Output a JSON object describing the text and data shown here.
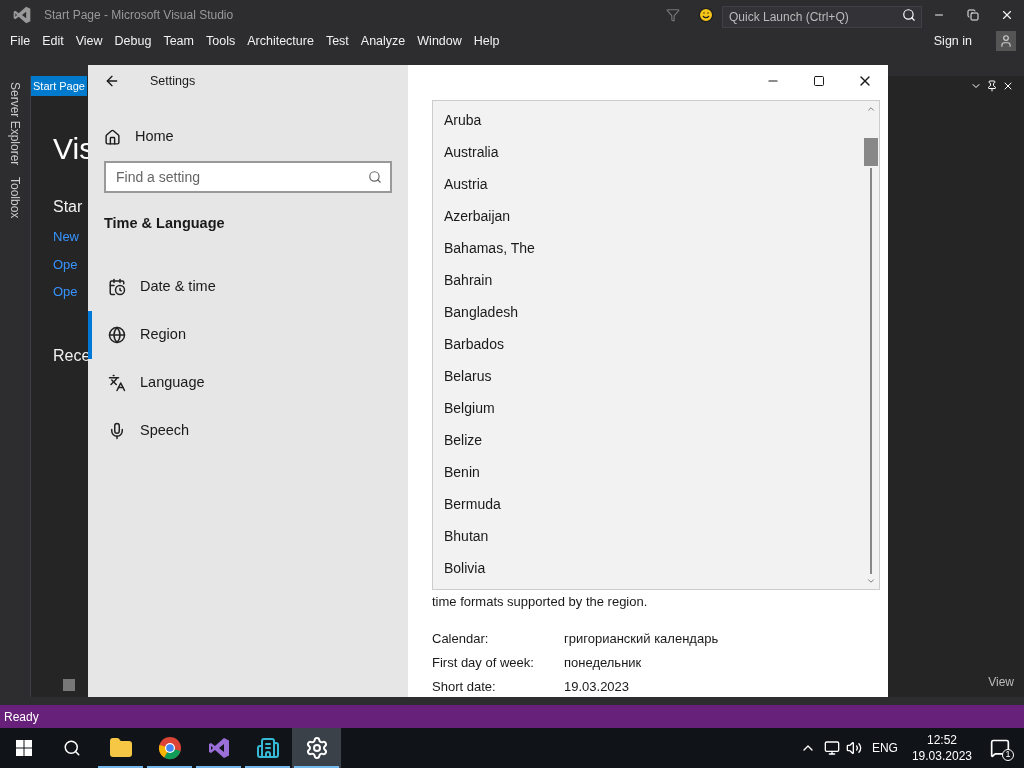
{
  "vs": {
    "title": "Start Page - Microsoft Visual Studio",
    "quick_launch": {
      "placeholder": "Quick Launch (Ctrl+Q)"
    },
    "menu": [
      "File",
      "Edit",
      "View",
      "Debug",
      "Team",
      "Tools",
      "Architecture",
      "Test",
      "Analyze",
      "Window",
      "Help"
    ],
    "sign_in": "Sign in",
    "side_tabs": [
      "Server Explorer",
      "Toolbox"
    ],
    "doc_tab": "Start Page",
    "start_page": {
      "heading": "Vis",
      "start_heading": "Star",
      "links": [
        "New",
        "Ope",
        "Ope"
      ],
      "recent_heading": "Rece"
    },
    "right_panel_footer": "View",
    "status": "Ready"
  },
  "settings": {
    "title": "Settings",
    "home": "Home",
    "search": {
      "placeholder": "Find a setting"
    },
    "section": "Time & Language",
    "nav": [
      {
        "label": "Date & time",
        "kind": "calendar",
        "selected": false
      },
      {
        "label": "Region",
        "kind": "globe",
        "selected": true
      },
      {
        "label": "Language",
        "kind": "language",
        "selected": false
      },
      {
        "label": "Speech",
        "kind": "mic",
        "selected": false
      }
    ],
    "country_list": [
      "Aruba",
      "Australia",
      "Austria",
      "Azerbaijan",
      "Bahamas, The",
      "Bahrain",
      "Bangladesh",
      "Barbados",
      "Belarus",
      "Belgium",
      "Belize",
      "Benin",
      "Bermuda",
      "Bhutan",
      "Bolivia"
    ],
    "region_text": "time formats supported by the region.",
    "formats": [
      {
        "label": "Calendar:",
        "value": "григорианский календарь"
      },
      {
        "label": "First day of week:",
        "value": "понедельник"
      },
      {
        "label": "Short date:",
        "value": "19.03.2023"
      }
    ]
  },
  "taskbar": {
    "apps": [
      {
        "kind": "files",
        "running": true,
        "selected": false
      },
      {
        "kind": "browser",
        "running": true,
        "selected": false
      },
      {
        "kind": "vs",
        "running": true,
        "selected": false
      },
      {
        "kind": "buildings",
        "running": true,
        "selected": false
      },
      {
        "kind": "settings",
        "running": true,
        "selected": true
      }
    ],
    "language": "ENG",
    "time": "12:52",
    "date": "19.03.2023",
    "notifications": "1"
  }
}
